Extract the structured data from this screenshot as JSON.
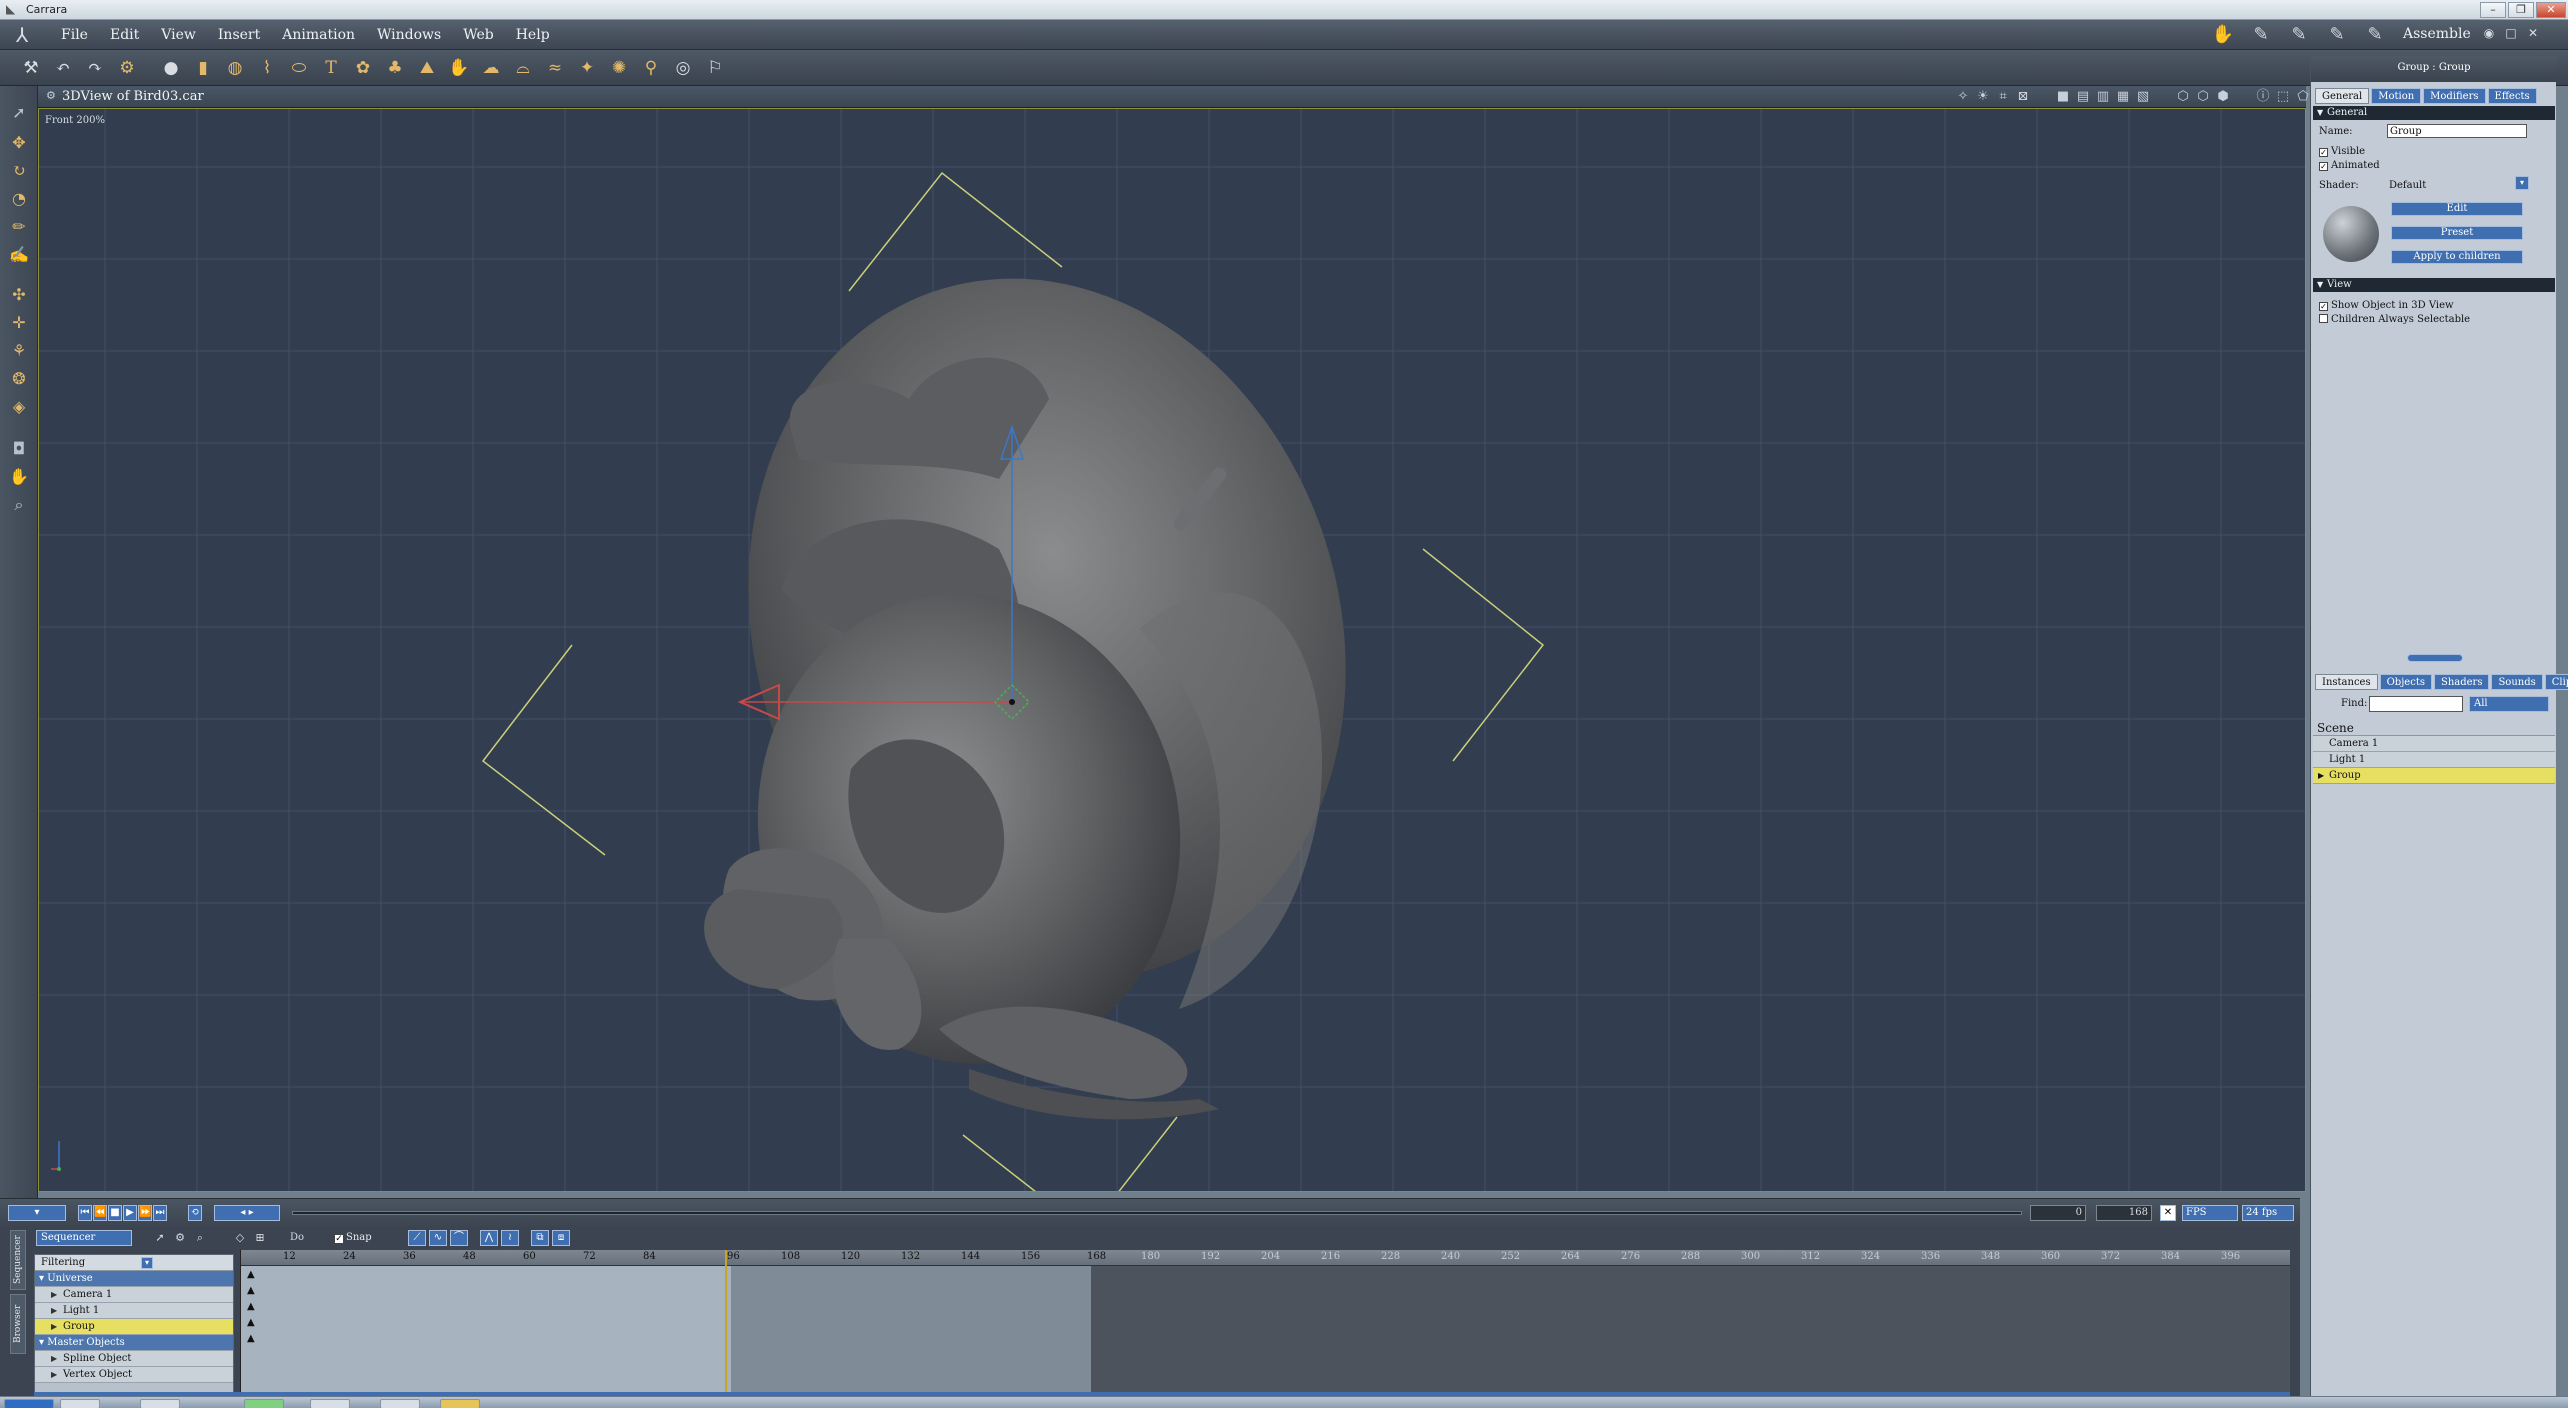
{
  "window": {
    "title": "Carrara",
    "min": "–",
    "max": "❐",
    "close": "✕"
  },
  "menus": [
    "File",
    "Edit",
    "View",
    "Insert",
    "Animation",
    "Windows",
    "Web",
    "Help"
  ],
  "room": {
    "label": "Assemble"
  },
  "view": {
    "title": "3DView of Bird03.car",
    "camera_label": "Front 200%"
  },
  "transport": {
    "start_value": "0",
    "end_value": "168",
    "fps_mode": "FPS",
    "fps_value": "24 fps"
  },
  "sequencer": {
    "mode": "Sequencer",
    "filtering_label": "Filtering",
    "snap_label": "Snap",
    "do_label": "Do",
    "tab_sequencer": "Sequencer",
    "tab_other": "Browser",
    "ruler_ticks": [
      "12",
      "24",
      "36",
      "48",
      "60",
      "72",
      "84",
      "96",
      "108",
      "120",
      "132",
      "144",
      "156",
      "168",
      "180",
      "192",
      "204",
      "216",
      "228",
      "240",
      "252",
      "264",
      "276",
      "288",
      "300",
      "312",
      "324",
      "336",
      "348",
      "360",
      "372",
      "384",
      "396"
    ],
    "tree": {
      "universe": "Universe",
      "camera": "Camera 1",
      "light": "Light 1",
      "group": "Group",
      "master": "Master Objects",
      "spline": "Spline Object",
      "vertex": "Vertex Object"
    }
  },
  "properties": {
    "title": "Group : Group",
    "tabs": [
      "General",
      "Motion",
      "Modifiers",
      "Effects"
    ],
    "general_section": "General",
    "name_label": "Name:",
    "name_value": "Group",
    "visible_label": "Visible",
    "animated_label": "Animated",
    "shader_label": "Shader:",
    "shader_value": "Default",
    "edit_button": "Edit",
    "preset_button": "Preset",
    "apply_button": "Apply to children",
    "view_section": "View",
    "show_object_label": "Show Object in 3D View",
    "children_label": "Children Always Selectable"
  },
  "browser": {
    "tabs": [
      "Instances",
      "Objects",
      "Shaders",
      "Sounds",
      "Clips"
    ],
    "find_label": "Find:",
    "find_value": "",
    "find_filter": "All",
    "scene_head": "Scene",
    "items": [
      "Camera 1",
      "Light 1",
      "Group"
    ]
  }
}
